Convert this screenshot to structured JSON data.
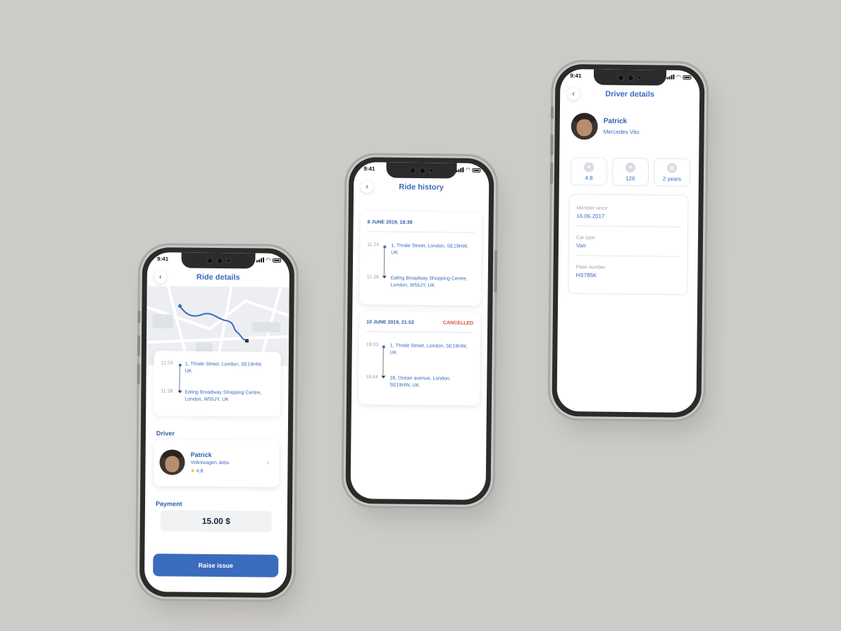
{
  "status_time": "9:41",
  "ride_details": {
    "title": "Ride details",
    "stops": [
      {
        "time": "11:24",
        "address": "1, Thrale Street, London, SE19HW, UK"
      },
      {
        "time": "11:38",
        "address": "Ealing Broadway Shopping Centre, London, W55JY, UK"
      }
    ],
    "driver_label": "Driver",
    "driver": {
      "name": "Patrick",
      "car": "Volkswagen Jetta",
      "rating": "4.8"
    },
    "payment_label": "Payment",
    "payment_amount": "15.00 $",
    "button_label": "Raise issue"
  },
  "ride_history": {
    "title": "Ride history",
    "rides": [
      {
        "date": "8 JUNE 2019, 18:39",
        "status": "",
        "stops": [
          {
            "time": "11:24",
            "address": "1, Thrale Street, London, SE19HW, UK"
          },
          {
            "time": "11:38",
            "address": "Ealing Broadway Shopping Centre, London, W55JY, UK"
          }
        ]
      },
      {
        "date": "10 JUNE 2019, 21:53",
        "status": "CANCELLED",
        "stops": [
          {
            "time": "18:03",
            "address": "1, Thrale Street, London, SE19HW, UK"
          },
          {
            "time": "18:44",
            "address": "18, Ocean avenue, London, SE19HW, UK"
          }
        ]
      }
    ]
  },
  "driver_details": {
    "title": "Driver details",
    "name": "Patrick",
    "car": "Mercedes Vito",
    "stats": [
      {
        "icon": "star-icon",
        "value": "4.8"
      },
      {
        "icon": "heart-icon",
        "value": "126"
      },
      {
        "icon": "calendar-icon",
        "value": "2 years"
      }
    ],
    "info": [
      {
        "label": "Member since",
        "value": "16.06.2017"
      },
      {
        "label": "Car type",
        "value": "Van"
      },
      {
        "label": "Plate number",
        "value": "HS785K"
      }
    ]
  },
  "colors": {
    "accent": "#3a6bbd",
    "cancelled": "#e0463f",
    "background": "#cdcbc7"
  }
}
